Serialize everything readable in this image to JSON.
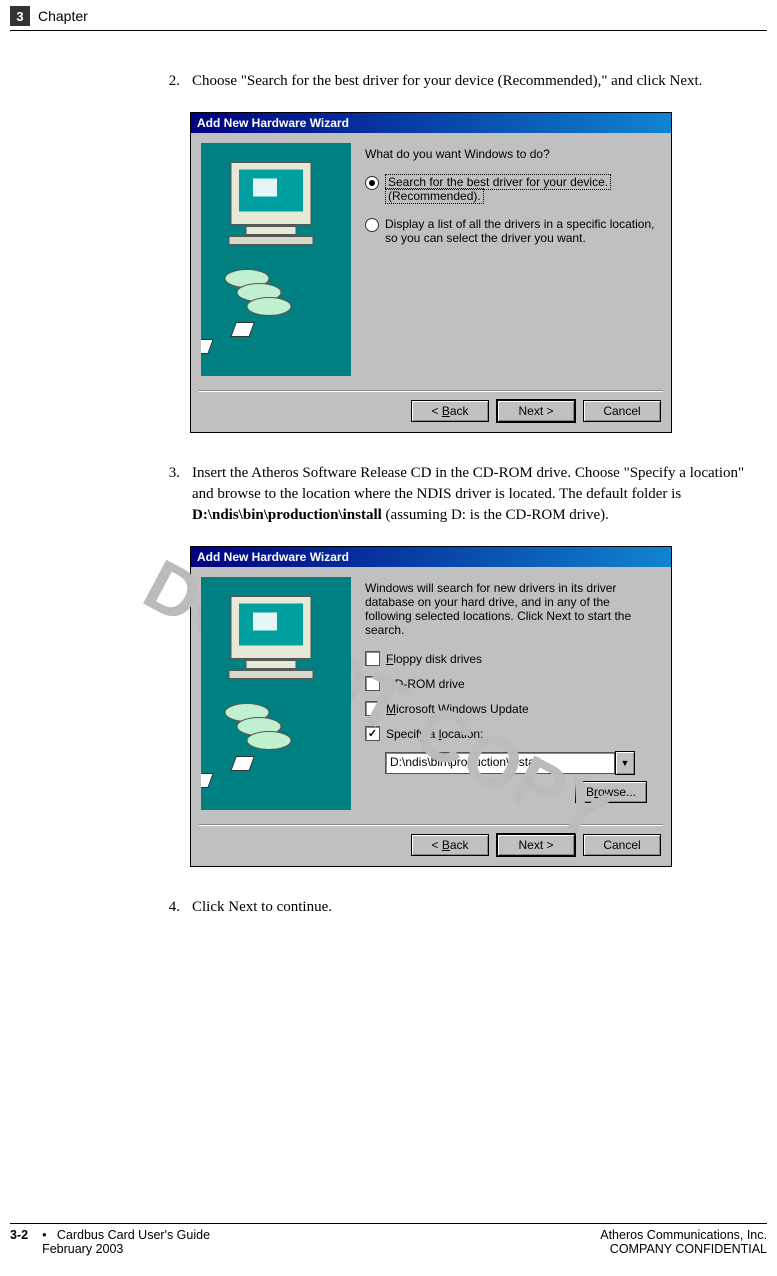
{
  "header": {
    "chapter_number": "3",
    "chapter_label": "Chapter"
  },
  "watermark": "DO NOT COPY",
  "steps": {
    "s2": {
      "num": "2.",
      "text": "Choose \"Search for the best driver for your device (Recommended),\" and click Next."
    },
    "s3": {
      "num": "3.",
      "text_a": "Insert the Atheros Software Release CD in the CD-ROM drive. Choose \"Specify a location\" and browse to the location where the NDIS driver is located. The default folder is ",
      "path": "D:\\ndis\\bin\\production\\install",
      "text_b": " (assuming D: is the CD-ROM drive)."
    },
    "s4": {
      "num": "4.",
      "text": "Click Next to continue."
    }
  },
  "wizard1": {
    "title": "Add New Hardware Wizard",
    "prompt": "What do you want Windows to do?",
    "option1_a": "Search for the best driver for your device.",
    "option1_b": "(Recommended).",
    "option2": "Display a list of all the drivers in a specific location, so you can select the driver you want.",
    "back": "< Back",
    "next": "Next >",
    "cancel": "Cancel"
  },
  "wizard2": {
    "title": "Add New Hardware Wizard",
    "prompt": "Windows will search for new drivers in its driver database on your hard drive, and in any of the following selected locations. Click Next to start the search.",
    "opt_floppy_pre": "F",
    "opt_floppy": "loppy disk drives",
    "opt_cd_pre": "C",
    "opt_cd": "D-ROM drive",
    "opt_ms_pre": "M",
    "opt_ms": "icrosoft Windows Update",
    "opt_loc_pre": "Specify a ",
    "opt_loc_u": "l",
    "opt_loc_post": "ocation:",
    "location_value": "D:\\ndis\\bin\\production\\install",
    "browse_pre": "B",
    "browse_u": "r",
    "browse_post": "owse...",
    "back": "< Back",
    "next": "Next >",
    "cancel": "Cancel"
  },
  "footer": {
    "page": "3-2",
    "bullet": "•",
    "title": "Cardbus Card User's Guide",
    "date": "February 2003",
    "company": "Atheros Communications, Inc.",
    "confidential": "COMPANY CONFIDENTIAL"
  }
}
